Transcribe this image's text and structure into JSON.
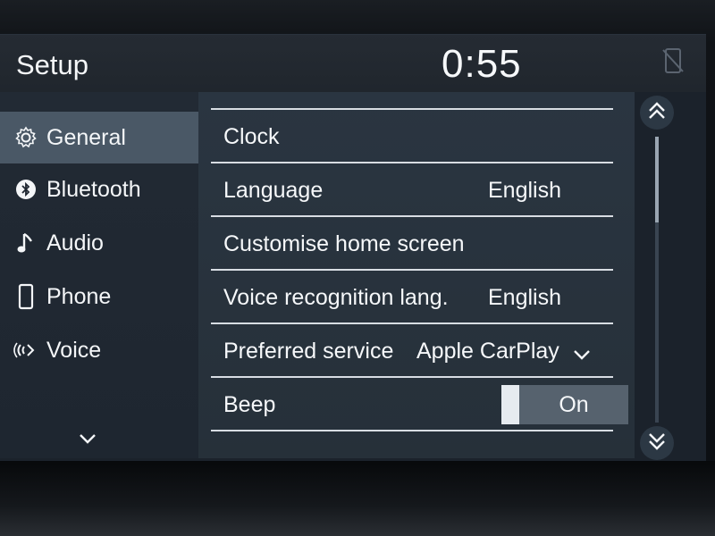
{
  "header": {
    "title": "Setup",
    "clock": "0:55",
    "phone_status_icon": "phone-disconnected-icon"
  },
  "sidebar": {
    "items": [
      {
        "label": "General",
        "icon": "gear-icon",
        "active": true
      },
      {
        "label": "Bluetooth",
        "icon": "bluetooth-icon",
        "active": false
      },
      {
        "label": "Audio",
        "icon": "music-note-icon",
        "active": false
      },
      {
        "label": "Phone",
        "icon": "phone-icon",
        "active": false
      },
      {
        "label": "Voice",
        "icon": "voice-icon",
        "active": false
      }
    ],
    "more_icon": "chevron-down-icon"
  },
  "settings": {
    "rows": [
      {
        "label": "Clock",
        "value": ""
      },
      {
        "label": "Language",
        "value": "English"
      },
      {
        "label": "Customise home screen",
        "value": ""
      },
      {
        "label": "Voice recognition lang.",
        "value": "English"
      },
      {
        "label": "Preferred service",
        "value": "Apple CarPlay"
      },
      {
        "label": "Beep",
        "value": "On"
      }
    ]
  },
  "scroll": {
    "up_icon": "double-chevron-up-icon",
    "down_icon": "double-chevron-down-icon"
  },
  "colors": {
    "active_item": "#4a5866",
    "divider": "#d8dde3",
    "text": "#f4f6f8"
  }
}
